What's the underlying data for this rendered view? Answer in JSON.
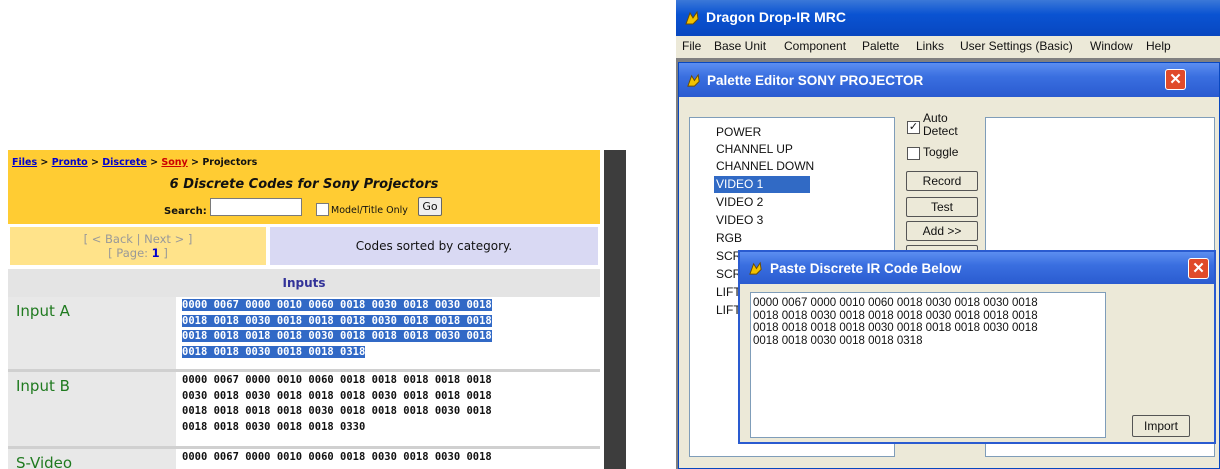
{
  "web": {
    "breadcrumb": {
      "files": "Files",
      "sep1": " > ",
      "pronto": "Pronto",
      "sep2": " > ",
      "discrete": "Discrete",
      "sep3": " > ",
      "sony": "Sony",
      "sep4": " > ",
      "projectors": "Projectors"
    },
    "title": "6 Discrete Codes for Sony Projectors",
    "search_label": "Search:",
    "model_only_label": "Model/Title Only",
    "go_label": "Go",
    "nav_links": "[ < Back | Next > ]",
    "page_prefix": "[ Page: ",
    "page_number": "1",
    "page_suffix": " ]",
    "sorted_text": "Codes sorted by category.",
    "category": "Inputs",
    "rows": [
      {
        "name": "Input A",
        "code": "0000 0067 0000 0010 0060 0018 0030 0018 0030 0018\n0018 0018 0030 0018 0018 0018 0030 0018 0018 0018\n0018 0018 0018 0018 0030 0018 0018 0018 0030 0018\n0018 0018 0030 0018 0018 0318"
      },
      {
        "name": "Input B",
        "code": "0000 0067 0000 0010 0060 0018 0018 0018 0018 0018\n0030 0018 0030 0018 0018 0018 0030 0018 0018 0018\n0018 0018 0018 0018 0030 0018 0018 0018 0030 0018\n0018 0018 0030 0018 0018 0330"
      },
      {
        "name": "S-Video",
        "code": "0000 0067 0000 0010 0060 0018 0030 0018 0030 0018"
      }
    ]
  },
  "app": {
    "title": "Dragon Drop-IR MRC",
    "menu": [
      "File",
      "Base Unit",
      "Component",
      "Palette",
      "Links",
      "User Settings (Basic)",
      "Window",
      "Help"
    ],
    "palette_title": "Palette Editor SONY PROJECTOR",
    "close_glyph": "✕",
    "items": [
      "POWER",
      "CHANNEL UP",
      "CHANNEL DOWN",
      "VIDEO 1",
      "VIDEO 2",
      "VIDEO 3",
      "RGB",
      "SCR",
      "SCR",
      "LIFT",
      "LIFT"
    ],
    "selected_item": "VIDEO 1",
    "auto_detect_line1": "Auto",
    "auto_detect_line2": "Detect",
    "auto_detect_checked": "✓",
    "toggle_label": "Toggle",
    "record_label": "Record",
    "test_label": "Test",
    "add_label": "Add >>",
    "paste_title": "Paste Discrete IR Code Below",
    "paste_code": "0000 0067 0000 0010 0060 0018 0030 0018 0030 0018\n0018 0018 0030 0018 0018 0018 0030 0018 0018 0018\n0018 0018 0018 0018 0030 0018 0018 0018 0030 0018\n0018 0018 0030 0018 0018 0318",
    "import_label": "Import",
    "colors": {
      "titlebar": "#0a53d2",
      "selection": "#316ac5",
      "close": "#e04a2a",
      "web_header": "#ffcc33",
      "web_green": "#1f7a1f"
    }
  }
}
